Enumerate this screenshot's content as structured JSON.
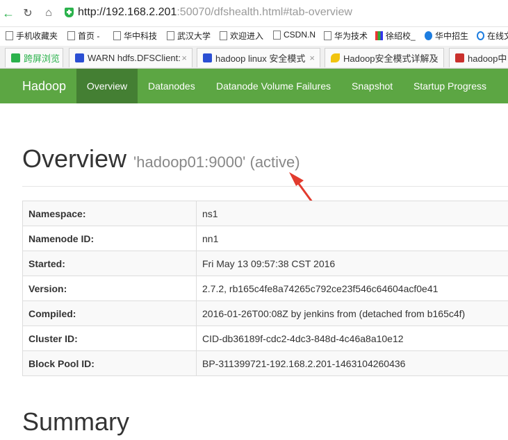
{
  "browser": {
    "url_host": "http://192.168.2.201",
    "url_rest": ":50070/dfshealth.html#tab-overview"
  },
  "bookmarks": [
    "手机收藏夹",
    "首页 -",
    "华中科技",
    "武汉大学",
    "欢迎进入",
    "CSDN.N",
    "华为技术",
    "徐绍校_",
    "华中招生",
    "在线文"
  ],
  "tabs": [
    "跨屏浏览",
    "WARN hdfs.DFSClient:",
    "hadoop linux 安全模式",
    "Hadoop安全模式详解及",
    "hadoop中"
  ],
  "navbar": {
    "brand": "Hadoop",
    "items": [
      "Overview",
      "Datanodes",
      "Datanode Volume Failures",
      "Snapshot",
      "Startup Progress"
    ]
  },
  "overview": {
    "heading": "Overview",
    "subheading": "'hadoop01:9000' (active)",
    "rows": [
      {
        "label": "Namespace:",
        "value": "ns1"
      },
      {
        "label": "Namenode ID:",
        "value": "nn1"
      },
      {
        "label": "Started:",
        "value": "Fri May 13 09:57:38 CST 2016"
      },
      {
        "label": "Version:",
        "value": "2.7.2, rb165c4fe8a74265c792ce23f546c64604acf0e41"
      },
      {
        "label": "Compiled:",
        "value": "2016-01-26T00:08Z by jenkins from (detached from b165c4f)"
      },
      {
        "label": "Cluster ID:",
        "value": "CID-db36189f-cdc2-4dc3-848d-4c46a8a10e12"
      },
      {
        "label": "Block Pool ID:",
        "value": "BP-311399721-192.168.2.201-1463104260436"
      }
    ]
  },
  "summary": {
    "heading": "Summary"
  },
  "colors": {
    "navbar": "#5ca643",
    "navbar_active": "#447f33",
    "arrow": "#e23b2e"
  }
}
